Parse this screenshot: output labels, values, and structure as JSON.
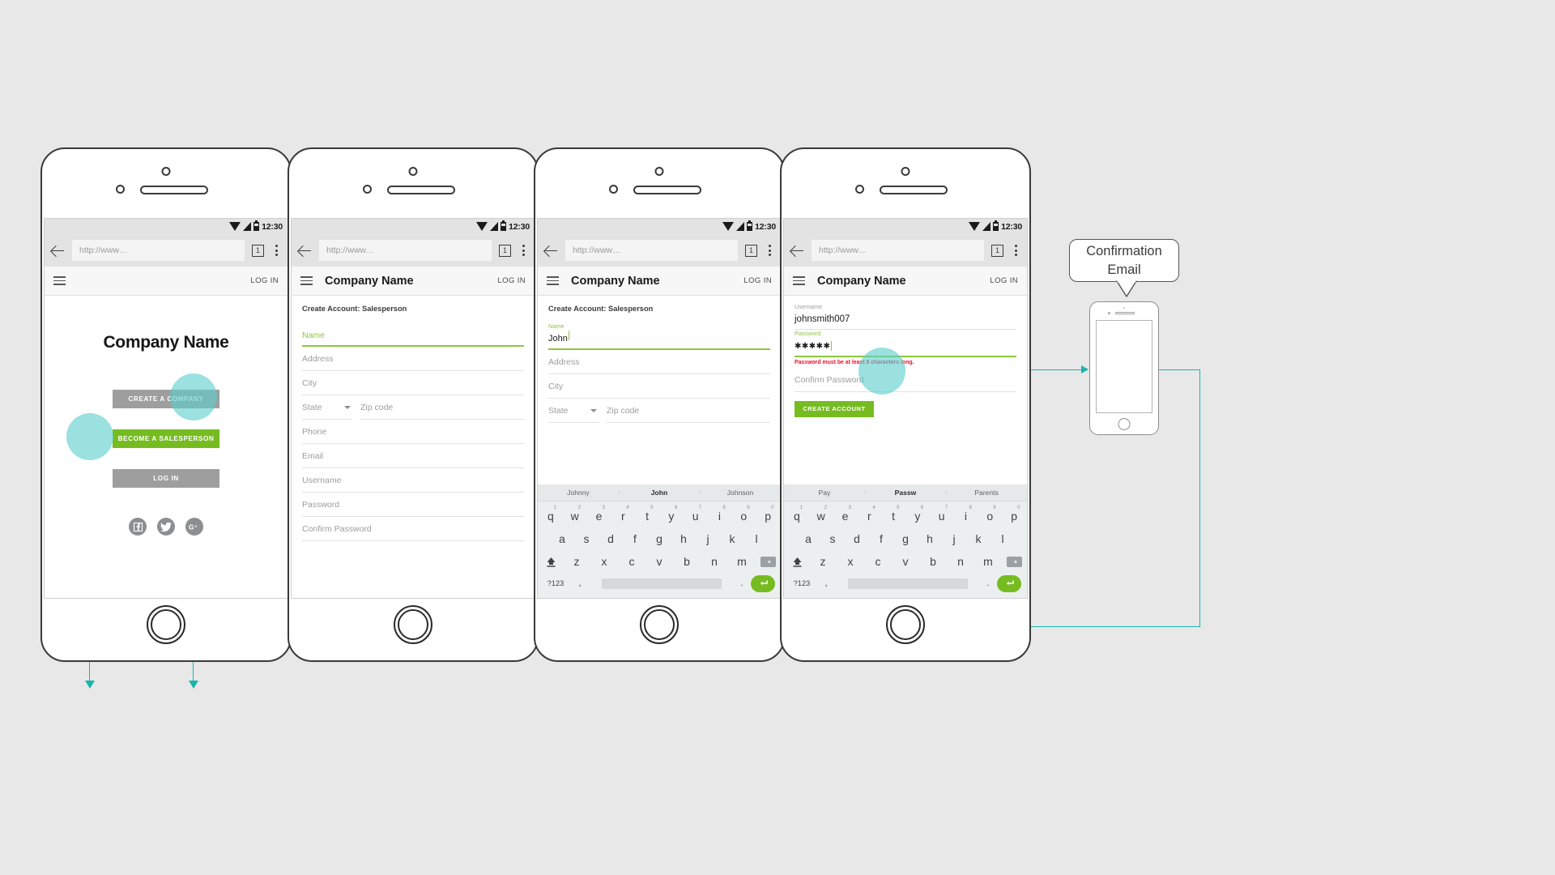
{
  "canvas": {
    "background": "#e8e8e8"
  },
  "theme": {
    "green": "#76bc21",
    "light_green": "#8cc63f",
    "grey_button": "#9e9e9e",
    "teal_connector": "#19b5ac",
    "teal_hotspot": "#5ccfcd",
    "error_red": "#e8112d"
  },
  "status_bar": {
    "time": "12:30",
    "icons": [
      "wifi-icon",
      "signal-icon",
      "battery-icon"
    ]
  },
  "browser_bar": {
    "url_placeholder": "http://www…",
    "tab_count": "1",
    "icons": [
      "back-arrow-icon",
      "tab-count-icon",
      "overflow-menu-icon"
    ]
  },
  "app_bar": {
    "title": "Company Name",
    "login_label": "LOG IN",
    "menu_icon": "hamburger-icon"
  },
  "screen1": {
    "name": "landing-screen",
    "heading": "Company Name",
    "buttons": [
      {
        "label": "CREATE A COMPANY",
        "style": "grey"
      },
      {
        "label": "BECOME A SALESPERSON",
        "style": "green"
      },
      {
        "label": "LOG IN",
        "style": "grey"
      }
    ],
    "social": [
      {
        "name": "facebook-icon",
        "glyph": "f"
      },
      {
        "name": "twitter-icon",
        "glyph": "t"
      },
      {
        "name": "google-plus-icon",
        "glyph": "G+"
      }
    ]
  },
  "screen2": {
    "name": "signup-form-empty",
    "form_heading": "Create Account: Salesperson",
    "fields": [
      {
        "label": "Name",
        "value": "",
        "state": "focused"
      },
      {
        "label": "Address",
        "value": "",
        "state": "empty"
      },
      {
        "label": "City",
        "value": "",
        "state": "empty"
      },
      {
        "label": "State",
        "value": "",
        "state": "select"
      },
      {
        "label": "Zip code",
        "value": "",
        "state": "empty"
      },
      {
        "label": "Phone",
        "value": "",
        "state": "empty"
      },
      {
        "label": "Email",
        "value": "",
        "state": "empty"
      },
      {
        "label": "Username",
        "value": "",
        "state": "empty"
      },
      {
        "label": "Password",
        "value": "",
        "state": "empty"
      },
      {
        "label": "Confirm Password",
        "value": "",
        "state": "empty"
      }
    ]
  },
  "screen3": {
    "name": "signup-form-typing-name",
    "form_heading": "Create Account: Salesperson",
    "fields": [
      {
        "label": "Name",
        "value": "John",
        "state": "focused-filled"
      },
      {
        "label": "Address",
        "value": "",
        "state": "empty"
      },
      {
        "label": "City",
        "value": "",
        "state": "empty"
      },
      {
        "label": "State",
        "value": "",
        "state": "select"
      },
      {
        "label": "Zip code",
        "value": "",
        "state": "empty"
      }
    ],
    "keyboard": {
      "suggestions": [
        "Johnny",
        "John",
        "Johnson"
      ],
      "active_suggestion": 1
    }
  },
  "screen4": {
    "name": "signup-form-password-error",
    "fields": [
      {
        "label": "Username",
        "value": "johnsmith007",
        "state": "filled"
      },
      {
        "label": "Password",
        "value": "✱✱✱✱✱",
        "state": "focused-filled"
      },
      {
        "label": "Confirm Password",
        "value": "",
        "state": "empty"
      }
    ],
    "error_message": "Password must be at least 8 characters long.",
    "submit_button": "CREATE ACCOUNT",
    "keyboard": {
      "suggestions": [
        "Pay",
        "Passw",
        "Parents"
      ],
      "active_suggestion": 1
    }
  },
  "keyboard_layout": {
    "row1": [
      {
        "key": "q",
        "num": "1"
      },
      {
        "key": "w",
        "num": "2"
      },
      {
        "key": "e",
        "num": "3"
      },
      {
        "key": "r",
        "num": "4"
      },
      {
        "key": "t",
        "num": "5"
      },
      {
        "key": "y",
        "num": "6"
      },
      {
        "key": "u",
        "num": "7"
      },
      {
        "key": "i",
        "num": "8"
      },
      {
        "key": "o",
        "num": "9"
      },
      {
        "key": "p",
        "num": "0"
      }
    ],
    "row2": [
      "a",
      "s",
      "d",
      "f",
      "g",
      "h",
      "j",
      "k",
      "l"
    ],
    "row3": [
      "z",
      "x",
      "c",
      "v",
      "b",
      "n",
      "m"
    ],
    "row4": {
      "numeric": "?123",
      "comma": ",",
      "period": ".",
      "space": "",
      "enter": "enter-icon"
    },
    "shift": "shift-icon",
    "delete": "backspace-icon"
  },
  "callout": {
    "line1": "Confirmation",
    "line2": "Email"
  },
  "mini_phone": {
    "name": "confirmation-email-phone",
    "screen_content": ""
  }
}
